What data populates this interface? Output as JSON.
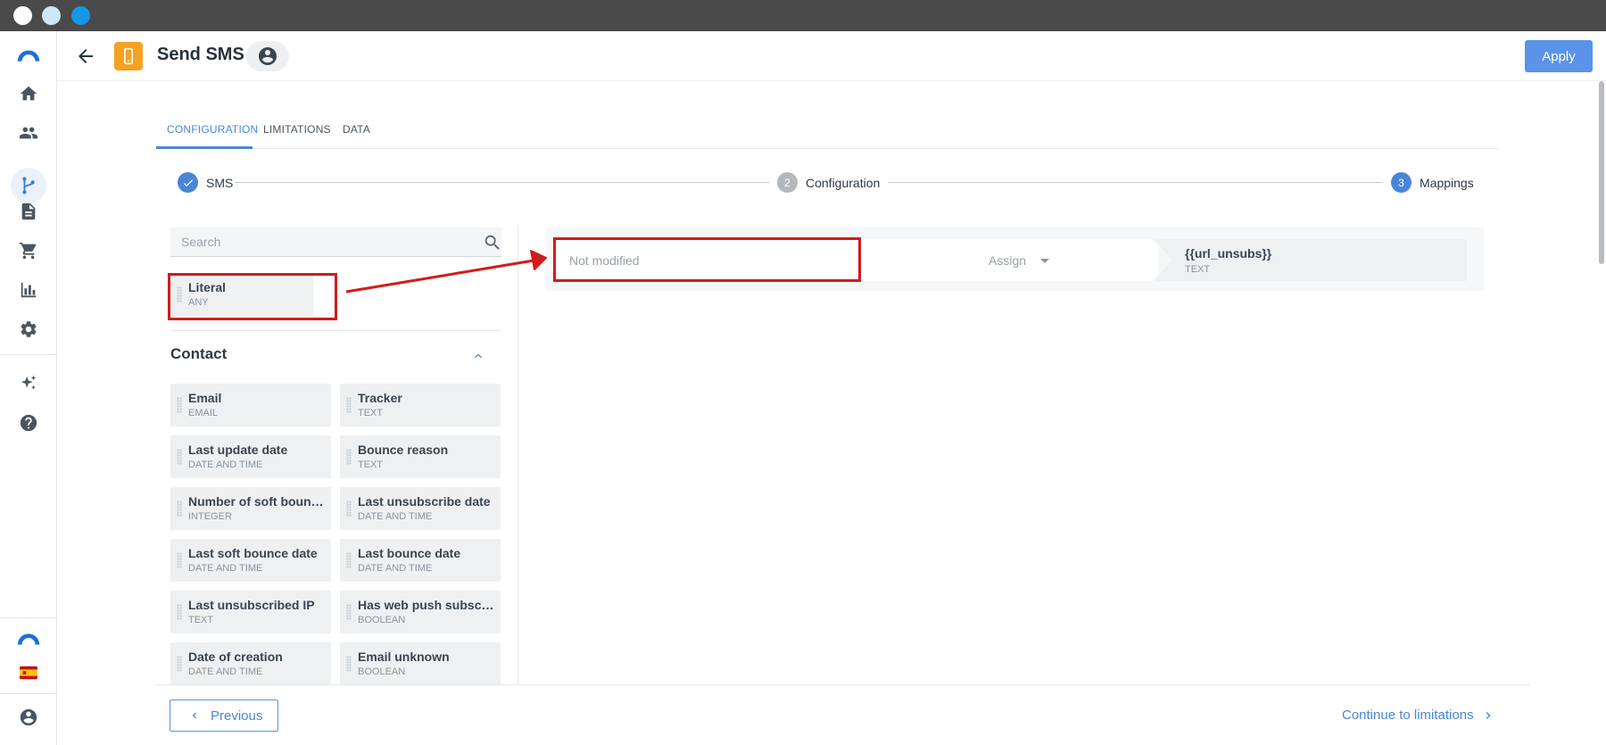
{
  "header": {
    "title": "Send SMS",
    "apply_label": "Apply"
  },
  "tabs": [
    {
      "label": "CONFIGURATION",
      "active": true
    },
    {
      "label": "LIMITATIONS",
      "active": false
    },
    {
      "label": "DATA",
      "active": false
    }
  ],
  "stepper": {
    "steps": [
      {
        "label": "SMS",
        "number": "1",
        "state": "done"
      },
      {
        "label": "Configuration",
        "number": "2",
        "state": "pending"
      },
      {
        "label": "Mappings",
        "number": "3",
        "state": "current"
      }
    ]
  },
  "left_panel": {
    "search_placeholder": "Search",
    "literal": {
      "name": "Literal",
      "type": "ANY"
    },
    "section_title": "Contact",
    "fields": [
      {
        "name": "Email",
        "type": "EMAIL"
      },
      {
        "name": "Tracker",
        "type": "TEXT"
      },
      {
        "name": "Last update date",
        "type": "DATE AND TIME"
      },
      {
        "name": "Bounce reason",
        "type": "TEXT"
      },
      {
        "name": "Number of soft bounces",
        "type": "INTEGER"
      },
      {
        "name": "Last unsubscribe date",
        "type": "DATE AND TIME"
      },
      {
        "name": "Last soft bounce date",
        "type": "DATE AND TIME"
      },
      {
        "name": "Last bounce date",
        "type": "DATE AND TIME"
      },
      {
        "name": "Last unsubscribed IP",
        "type": "TEXT"
      },
      {
        "name": "Has web push subscrip…",
        "type": "BOOLEAN"
      },
      {
        "name": "Date of creation",
        "type": "DATE AND TIME"
      },
      {
        "name": "Email unknown",
        "type": "BOOLEAN"
      }
    ]
  },
  "mapping": {
    "source_placeholder": "Not modified",
    "operator": "Assign",
    "target": {
      "name": "{{url_unsubs}}",
      "type": "TEXT"
    }
  },
  "footer": {
    "previous_label": "Previous",
    "continue_label": "Continue to limitations"
  },
  "colors": {
    "accent": "#4a86d8",
    "app_badge": "#f5a122",
    "annotation": "#d11b1b"
  },
  "icons": {
    "sidebar": [
      "logo-icon",
      "home-icon",
      "contacts-icon",
      "workflow-icon",
      "document-icon",
      "cart-icon",
      "chart-icon",
      "gear-icon",
      "sparkle-icon",
      "help-icon",
      "brand-icon",
      "flag-es-icon",
      "user-account-icon"
    ]
  }
}
